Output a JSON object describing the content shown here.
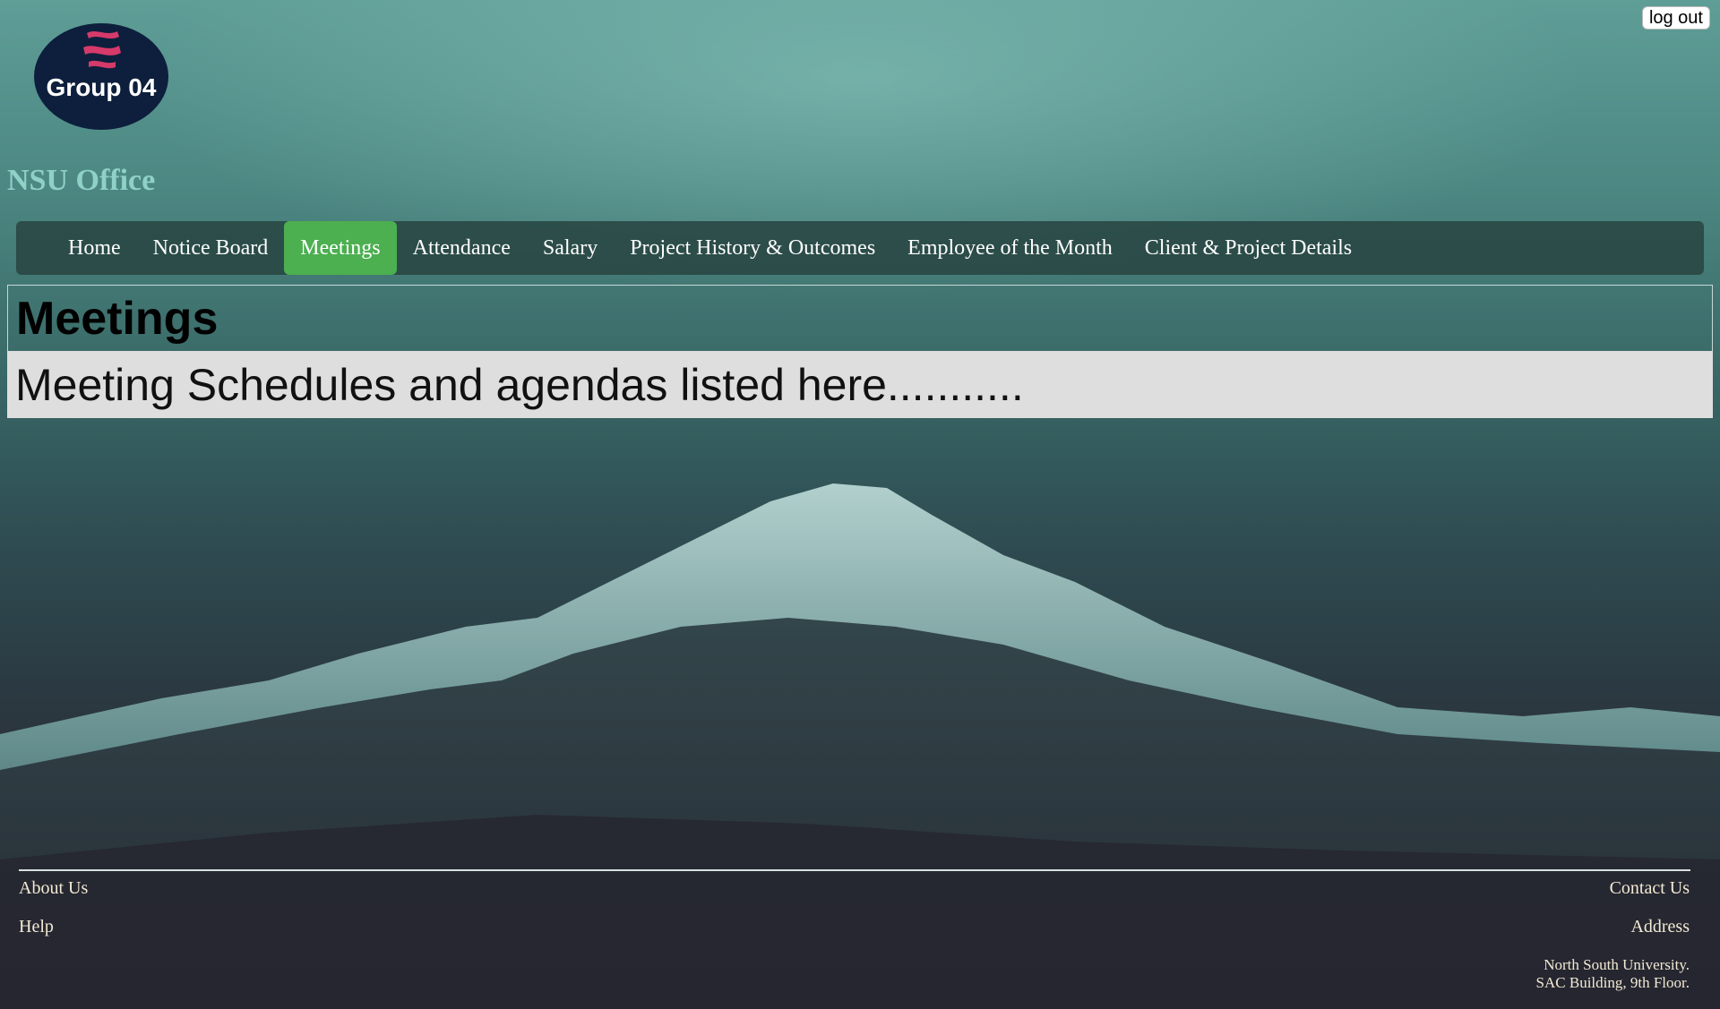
{
  "header": {
    "logout_label": "log out",
    "logo_text": "Group 04",
    "office_title": "NSU Office"
  },
  "nav": {
    "items": [
      {
        "label": "Home",
        "active": false
      },
      {
        "label": "Notice Board",
        "active": false
      },
      {
        "label": "Meetings",
        "active": true
      },
      {
        "label": "Attendance",
        "active": false
      },
      {
        "label": "Salary",
        "active": false
      },
      {
        "label": "Project History & Outcomes",
        "active": false
      },
      {
        "label": "Employee of the Month",
        "active": false
      },
      {
        "label": "Client & Project Details",
        "active": false
      }
    ]
  },
  "main": {
    "heading": "Meetings",
    "body_text": "Meeting Schedules and agendas listed here..........."
  },
  "footer": {
    "about_us": "About Us",
    "help": "Help",
    "contact_us": "Contact Us",
    "address_label": "Address",
    "address_line1": "North South University.",
    "address_line2": "SAC Building, 9th Floor."
  },
  "colors": {
    "nav_active": "#4caf50",
    "office_title": "#8fd1c6",
    "logo_bg": "#0d1f3c",
    "logo_accent": "#d63a6a"
  }
}
